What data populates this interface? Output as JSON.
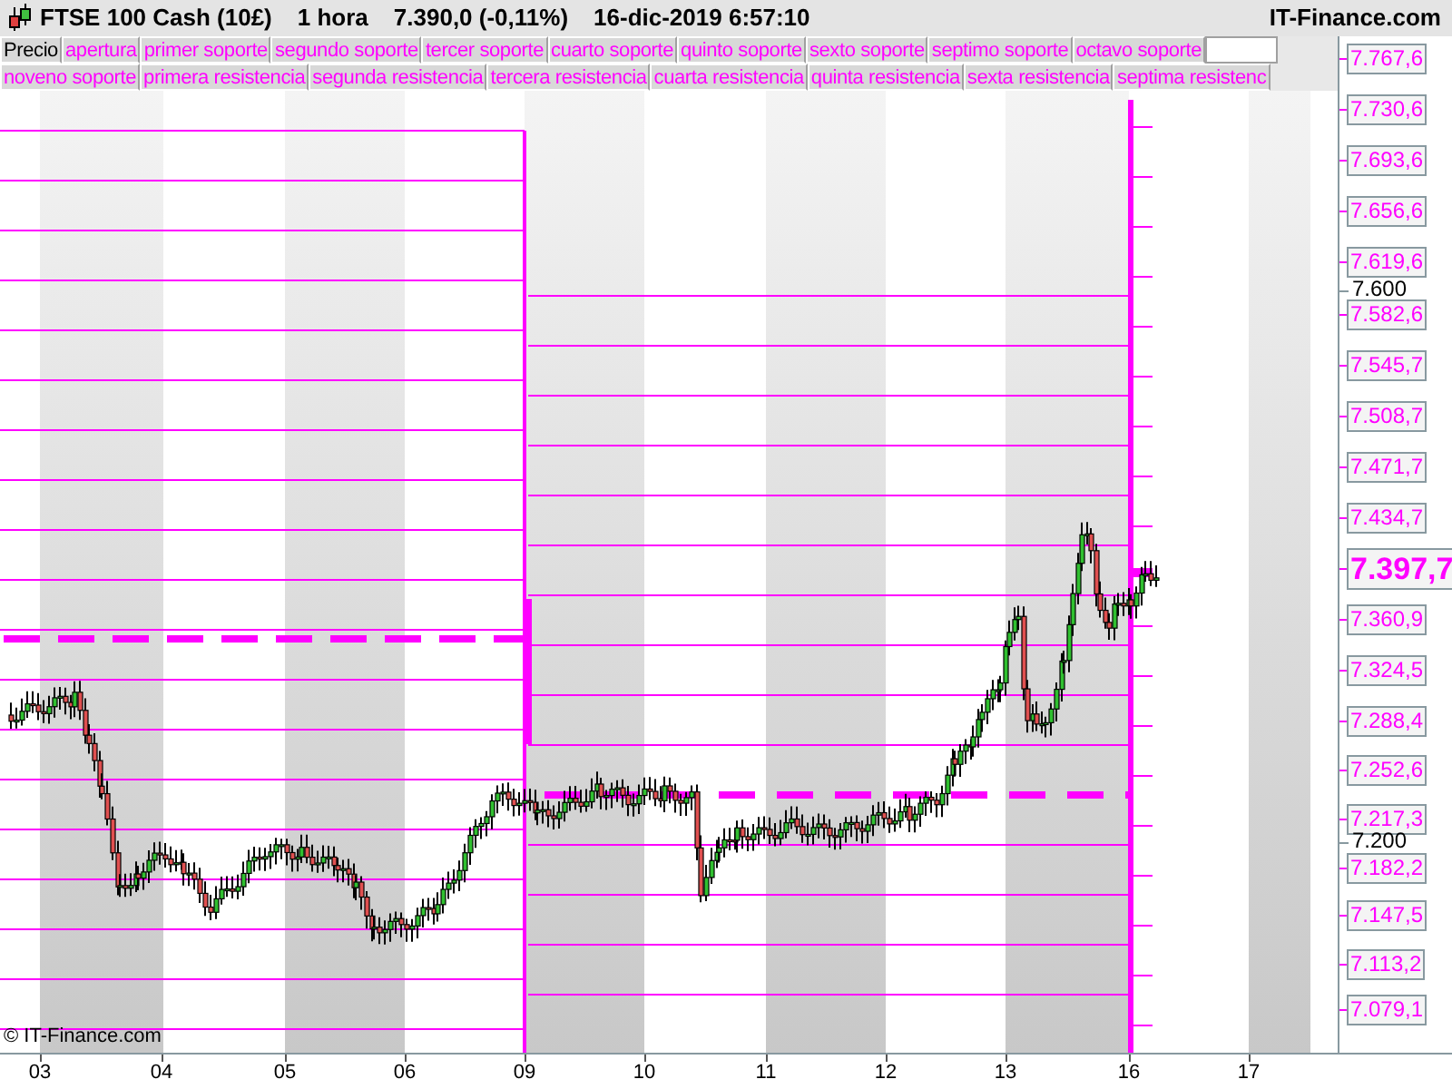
{
  "header": {
    "instrument": "FTSE 100 Cash (10£)",
    "timeframe": "1 hora",
    "price": "7.390,0 (-0,11%)",
    "datetime": "16-dic-2019 6:57:10",
    "brand": "IT-Finance.com"
  },
  "legend_rows": [
    [
      {
        "label": "Precio",
        "color": "#000000"
      },
      {
        "label": "apertura",
        "color": "#ff00ff"
      },
      {
        "label": "primer soporte",
        "color": "#ff00ff"
      },
      {
        "label": "segundo soporte",
        "color": "#ff00ff"
      },
      {
        "label": "tercer soporte",
        "color": "#ff00ff"
      },
      {
        "label": "cuarto soporte",
        "color": "#ff00ff"
      },
      {
        "label": "quinto soporte",
        "color": "#ff00ff"
      },
      {
        "label": "sexto soporte",
        "color": "#ff00ff"
      },
      {
        "label": "septimo soporte",
        "color": "#ff00ff"
      },
      {
        "label": "octavo soporte",
        "color": "#ff00ff"
      }
    ],
    [
      {
        "label": "noveno soporte",
        "color": "#ff00ff"
      },
      {
        "label": "primera resistencia",
        "color": "#ff00ff"
      },
      {
        "label": "segunda resistencia",
        "color": "#ff00ff"
      },
      {
        "label": "tercera resistencia",
        "color": "#ff00ff"
      },
      {
        "label": "cuarta resistencia",
        "color": "#ff00ff"
      },
      {
        "label": "quinta resistencia",
        "color": "#ff00ff"
      },
      {
        "label": "sexta resistencia",
        "color": "#ff00ff"
      },
      {
        "label": "septima resistenc",
        "color": "#ff00ff"
      }
    ]
  ],
  "price_axis": [
    {
      "kind": "level",
      "text": "7.767,6"
    },
    {
      "kind": "level",
      "text": "7.730,6"
    },
    {
      "kind": "level",
      "text": "7.693,6"
    },
    {
      "kind": "level",
      "text": "7.656,6"
    },
    {
      "kind": "level",
      "text": "7.619,6"
    },
    {
      "kind": "tick",
      "text": "7.600"
    },
    {
      "kind": "level",
      "text": "7.582,6"
    },
    {
      "kind": "level",
      "text": "7.545,7"
    },
    {
      "kind": "level",
      "text": "7.508,7"
    },
    {
      "kind": "level",
      "text": "7.471,7"
    },
    {
      "kind": "level",
      "text": "7.434,7"
    },
    {
      "kind": "current",
      "text": "7.397,7"
    },
    {
      "kind": "level",
      "text": "7.360,9"
    },
    {
      "kind": "level",
      "text": "7.324,5"
    },
    {
      "kind": "level",
      "text": "7.288,4"
    },
    {
      "kind": "level",
      "text": "7.252,6"
    },
    {
      "kind": "level",
      "text": "7.217,3"
    },
    {
      "kind": "tick",
      "text": "7.200"
    },
    {
      "kind": "level",
      "text": "7.182,2"
    },
    {
      "kind": "level",
      "text": "7.147,5"
    },
    {
      "kind": "level",
      "text": "7.113,2"
    },
    {
      "kind": "level",
      "text": "7.079,1"
    }
  ],
  "copyright": "© IT-Finance.com",
  "dates": [
    "03",
    "04",
    "05",
    "06",
    "09",
    "10",
    "11",
    "12",
    "13",
    "16",
    "17"
  ]
}
